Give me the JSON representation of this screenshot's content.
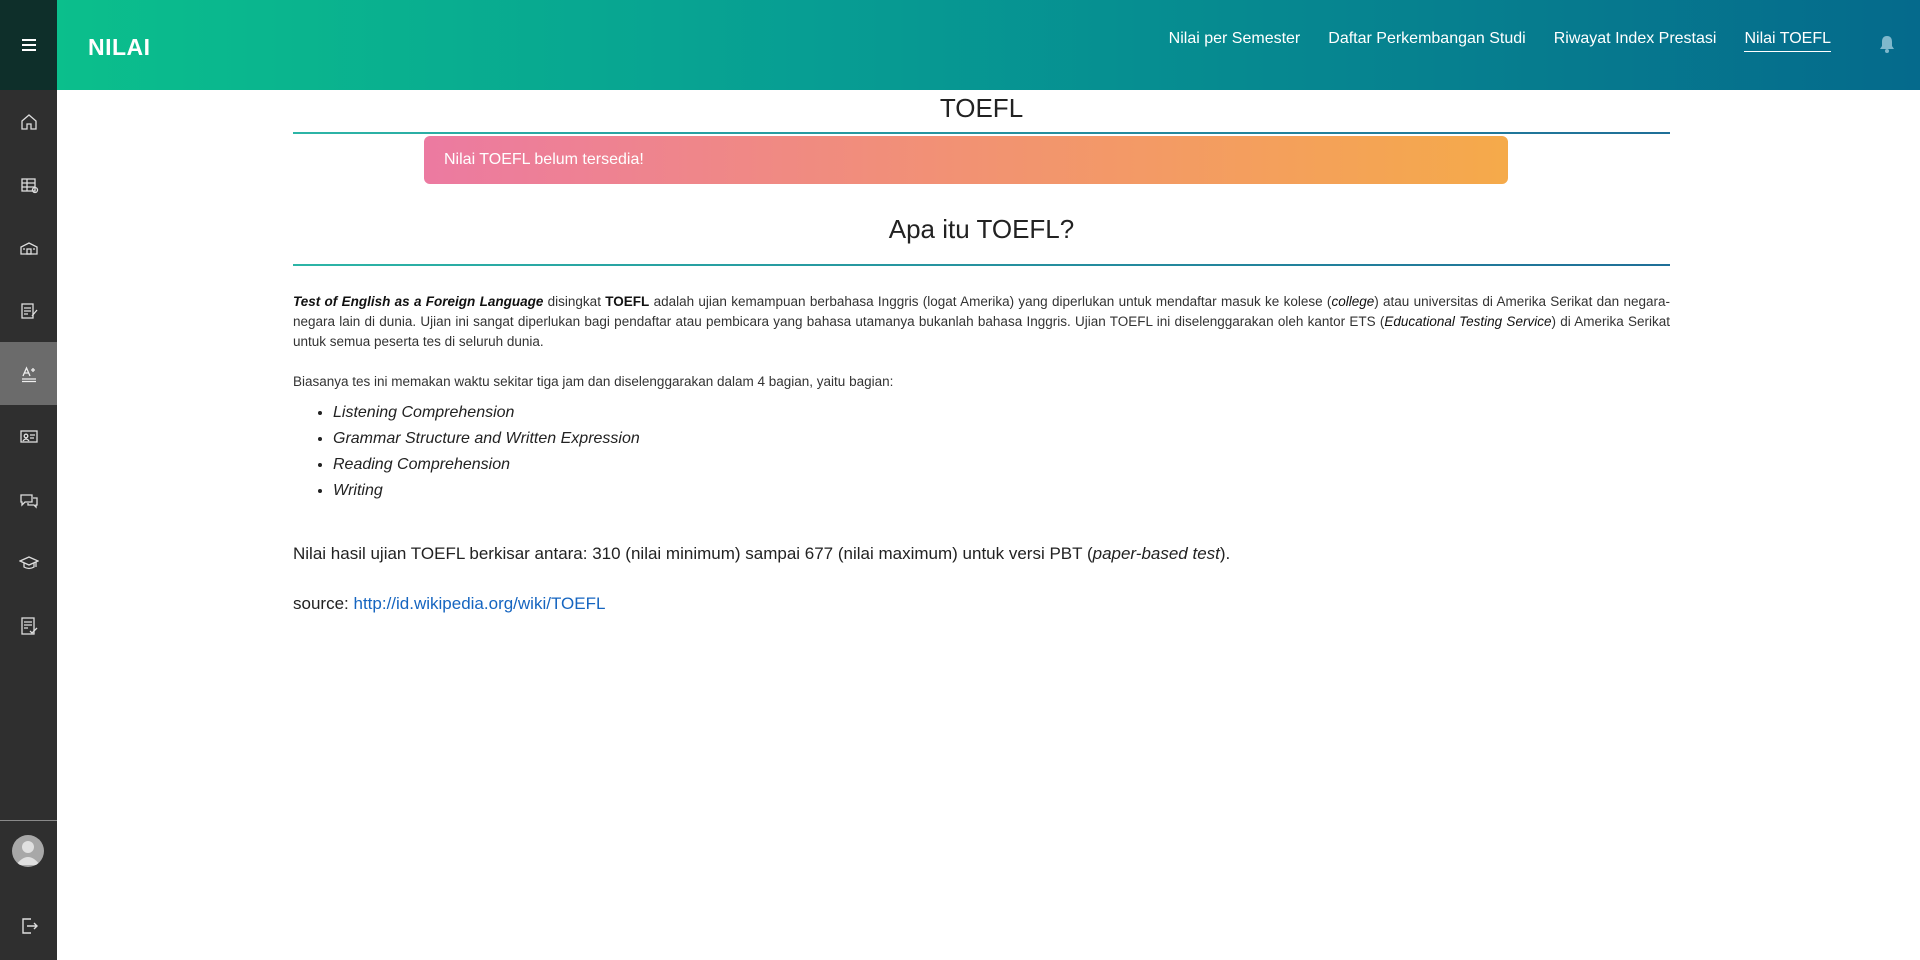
{
  "header": {
    "brand": "NILAI",
    "nav": [
      {
        "label": "Nilai per Semester",
        "active": false
      },
      {
        "label": "Daftar Perkembangan Studi",
        "active": false
      },
      {
        "label": "Riwayat Index Prestasi",
        "active": false
      },
      {
        "label": "Nilai TOEFL",
        "active": true
      }
    ],
    "bell_icon": "bell-icon"
  },
  "sidebar": {
    "items": [
      {
        "icon": "home-icon"
      },
      {
        "icon": "table-icon"
      },
      {
        "icon": "school-icon"
      },
      {
        "icon": "document-edit-icon"
      },
      {
        "icon": "text-grade-icon",
        "active": true
      },
      {
        "icon": "presentation-icon"
      },
      {
        "icon": "chat-icon"
      },
      {
        "icon": "graduation-cap-icon"
      },
      {
        "icon": "checklist-icon"
      }
    ],
    "avatar_icon": "user-avatar-icon",
    "logout_icon": "logout-icon"
  },
  "main": {
    "title": "TOEFL",
    "alert": "Nilai TOEFL belum tersedia!",
    "section_title": "Apa itu TOEFL?",
    "para1": {
      "lead": "Test of English as a Foreign Language",
      "t1": " disingkat ",
      "strong": "TOEFL",
      "t2": " adalah ujian kemampuan berbahasa Inggris (logat Amerika) yang diperlukan untuk mendaftar masuk ke kolese (",
      "it1": "college",
      "t3": ") atau universitas di Amerika Serikat dan negara-negara lain di dunia. Ujian ini sangat diperlukan bagi pendaftar atau pembicara yang bahasa utamanya bukanlah bahasa Inggris. Ujian TOEFL ini diselenggarakan oleh kantor ETS (",
      "it2": "Educational Testing Service",
      "t4": ") di Amerika Serikat untuk semua peserta tes di seluruh dunia."
    },
    "para2": "Biasanya tes ini memakan waktu sekitar tiga jam dan diselenggarakan dalam 4 bagian, yaitu bagian:",
    "parts": [
      "Listening Comprehension",
      "Grammar Structure and Written Expression",
      "Reading Comprehension",
      "Writing"
    ],
    "score": {
      "text": "Nilai hasil ujian TOEFL berkisar antara: 310 (nilai minimum) sampai 677 (nilai maximum) untuk versi PBT (",
      "it": "paper-based test",
      "end": ")."
    },
    "source": {
      "label": "source: ",
      "link": "http://id.wikipedia.org/wiki/TOEFL"
    }
  }
}
